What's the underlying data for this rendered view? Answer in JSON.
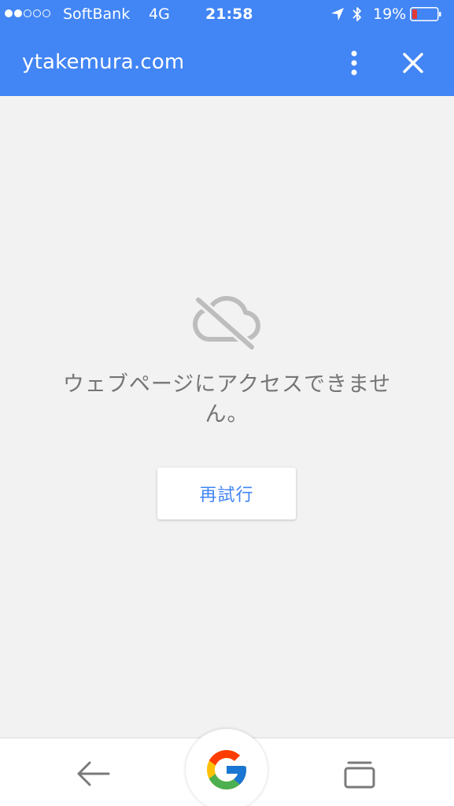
{
  "status_bar": {
    "carrier": "SoftBank",
    "network": "4G",
    "time": "21:58",
    "battery_percent": "19%",
    "signal_bars_filled": 2,
    "signal_bars_total": 5,
    "battery_level": 0.19,
    "battery_color": "#e53935"
  },
  "app_bar": {
    "title": "ytakemura.com",
    "menu_icon": "more-vert-icon",
    "close_icon": "close-icon",
    "color": "#4285f4"
  },
  "error": {
    "icon": "cloud-off-icon",
    "message": "ウェブページにアクセスできません。",
    "retry_label": "再試行"
  },
  "bottom_bar": {
    "back_icon": "back-arrow-icon",
    "google_icon": "google-logo-icon",
    "tabs_icon": "tabs-icon"
  }
}
